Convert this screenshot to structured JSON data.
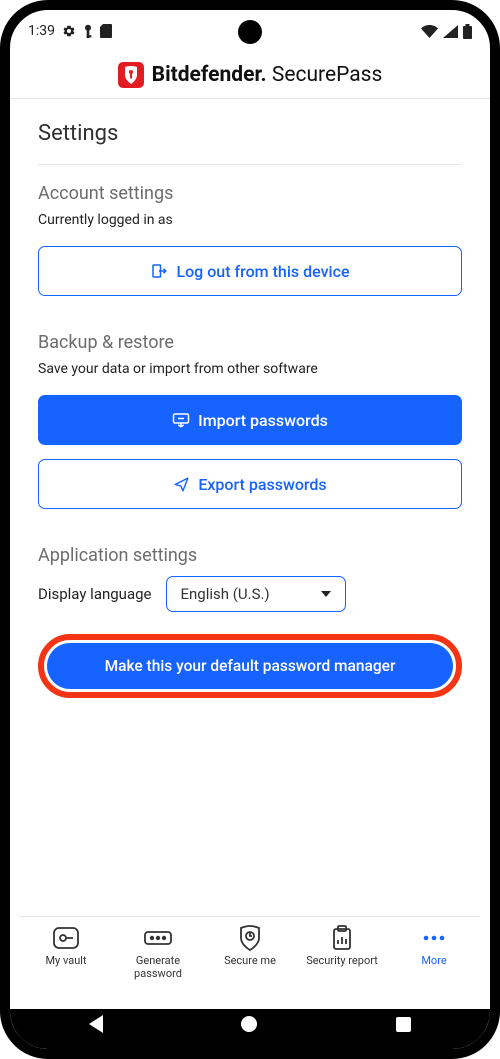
{
  "statusbar": {
    "time": "1:39"
  },
  "brand": {
    "name_bold": "Bitdefender",
    "name_light": "SecurePass"
  },
  "settings": {
    "title": "Settings",
    "account": {
      "heading": "Account settings",
      "logged_in_label": "Currently logged in as",
      "logout_label": "Log out from this device"
    },
    "backup": {
      "heading": "Backup & restore",
      "info": "Save your data or import from other software",
      "import_label": "Import passwords",
      "export_label": "Export passwords"
    },
    "app": {
      "heading": "Application settings",
      "language_label": "Display language",
      "language_value": "English (U.S.)",
      "default_label": "Make this your default password manager"
    }
  },
  "nav": {
    "items": [
      {
        "label": "My vault"
      },
      {
        "label": "Generate password"
      },
      {
        "label": "Secure me"
      },
      {
        "label": "Security report"
      },
      {
        "label": "More"
      }
    ]
  }
}
